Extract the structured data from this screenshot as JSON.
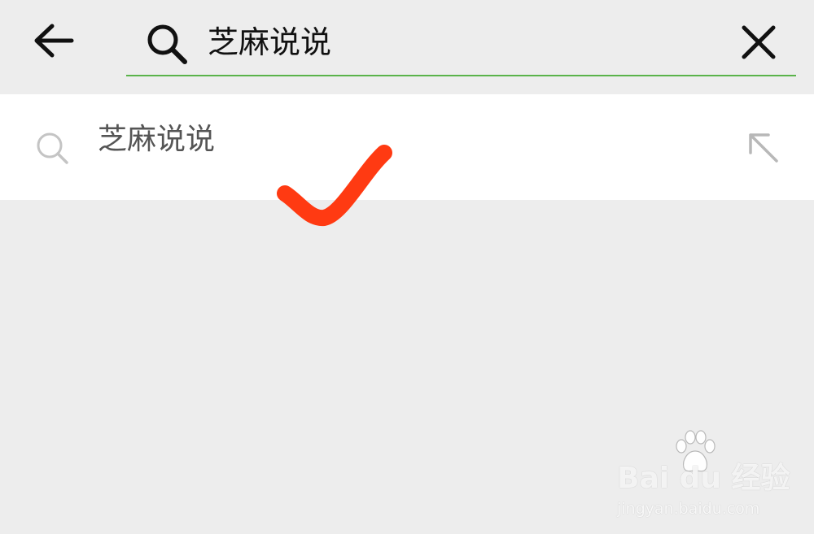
{
  "search": {
    "query": "芝麻说说",
    "underline_color": "#5ab34a"
  },
  "suggestions": [
    {
      "text": "芝麻说说"
    }
  ],
  "icons": {
    "back": "arrow-left-icon",
    "search": "search-icon",
    "clear": "close-icon",
    "row_search": "search-icon",
    "fill": "arrow-up-left-icon"
  },
  "annotation": {
    "check_color": "#ff3a12"
  },
  "watermark": {
    "brand": "Bai du 经验",
    "domain": "jingyan.baidu.com"
  }
}
